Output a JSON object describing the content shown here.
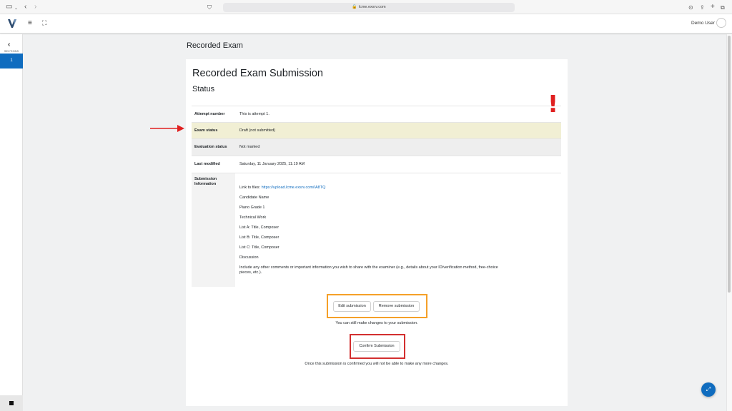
{
  "browser": {
    "url": "lcme.exsrv.com",
    "icons": [
      "sidebar-icon",
      "back-icon",
      "forward-icon",
      "shield-icon",
      "reader-icon",
      "lock-icon",
      "audio-icon",
      "reload-icon",
      "download-icon",
      "share-icon",
      "new-tab-icon",
      "tabs-overview-icon"
    ]
  },
  "header": {
    "user_name": "Demo User",
    "icons": [
      "logo",
      "hamburger-icon",
      "fullscreen-icon",
      "avatar"
    ]
  },
  "left_rail": {
    "label": "SECTIONS",
    "active_section": "1",
    "icons": [
      "chevron-left-icon",
      "square-icon"
    ]
  },
  "page": {
    "heading": "Recorded Exam",
    "card_title": "Recorded Exam Submission",
    "status_heading": "Status",
    "rows": [
      {
        "label": "Attempt number",
        "value": "This is attempt 1."
      },
      {
        "label": "Exam status",
        "value": "Draft (not submitted)"
      },
      {
        "label": "Evaluation status",
        "value": "Not marked"
      },
      {
        "label": "Last modified",
        "value": "Saturday, 11 January 2025, 11:19 AM"
      }
    ],
    "submission": {
      "label": "Submission Information",
      "link_prefix": "Link to files: ",
      "link_text": "https://upload.lcme.exsrv.com/IA8TQ",
      "lines": [
        "Candidate Name",
        "Piano Grade 1",
        "Technical Work",
        "List A: Title, Composer",
        "List B: Title, Composer",
        "List C: Title, Composer",
        "Discussion"
      ],
      "comment_line1": "Include any other comments or important information you wish to share with the examiner (e.g., details about your ID/verification method, free-choice",
      "comment_line2": "pieces, etc.)."
    },
    "buttons": {
      "edit": "Edit submission",
      "remove": "Remove submission",
      "edit_note": "You can still make changes to your submission.",
      "confirm": "Confirm Submission",
      "confirm_note": "Once this submission is confirmed you will not be able to make any more changes."
    }
  },
  "annotations": {
    "exclamation": "!",
    "colors": {
      "orange_box": "#f5a028",
      "red_box": "#d32f2f",
      "arrow": "#e02020",
      "highlight_row": "#f1efd4",
      "accent": "#0f6cbf"
    }
  }
}
